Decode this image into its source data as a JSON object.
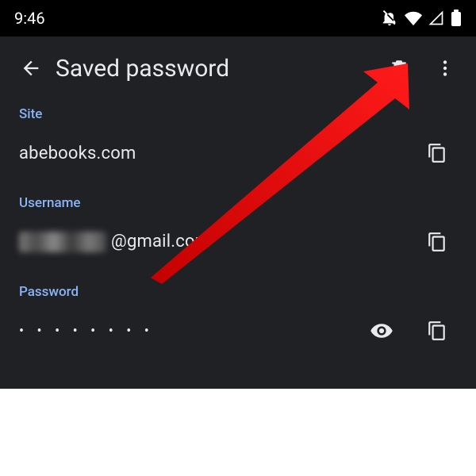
{
  "status": {
    "time": "9:46"
  },
  "appbar": {
    "title": "Saved password"
  },
  "fields": {
    "site": {
      "label": "Site",
      "value": "abebooks.com"
    },
    "username": {
      "label": "Username",
      "value_suffix": "@gmail.com"
    },
    "password": {
      "label": "Password",
      "masked": "• • • • • • • •"
    }
  }
}
